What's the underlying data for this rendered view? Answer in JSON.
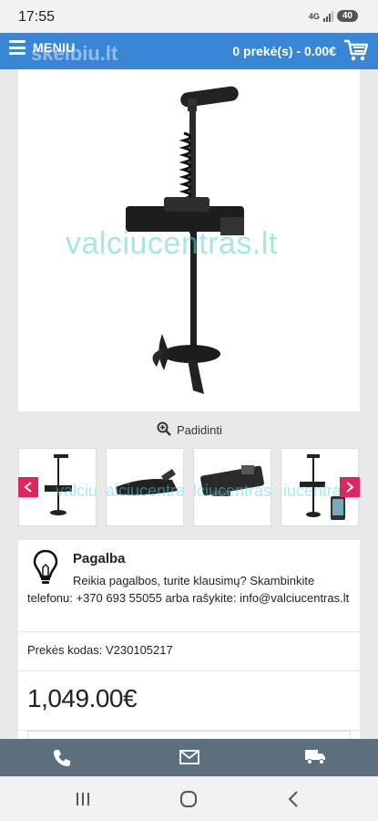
{
  "status_bar": {
    "time": "17:55",
    "network": "4G",
    "battery": "40"
  },
  "nav": {
    "menu_label": "MENIU",
    "logo": "skelbiu.lt",
    "cart": "0 prekė(s) - 0.00€"
  },
  "product": {
    "watermark": "valciucentras.lt",
    "zoom_label": "Padidinti",
    "thumb_watermark": "valciucentras.lt"
  },
  "help": {
    "title": "Pagalba",
    "text": "Reikia pagalbos, turite klausimų? Skambinkite telefonu: +370 693 55055 arba rašykite: info@valciucentras.lt"
  },
  "product_code": "Prekės kodas: V230105217",
  "price": "1,049.00€",
  "colors": {
    "nav_blue": "#3a86d6",
    "action_bar": "#5d6f7c",
    "arrow_red": "#e0245e"
  },
  "icons": {
    "menu": "hamburger-icon",
    "cart": "cart-icon",
    "zoom": "zoom-in-icon",
    "help": "lightbulb-icon",
    "phone": "phone-icon",
    "mail": "mail-icon",
    "delivery": "truck-icon"
  }
}
